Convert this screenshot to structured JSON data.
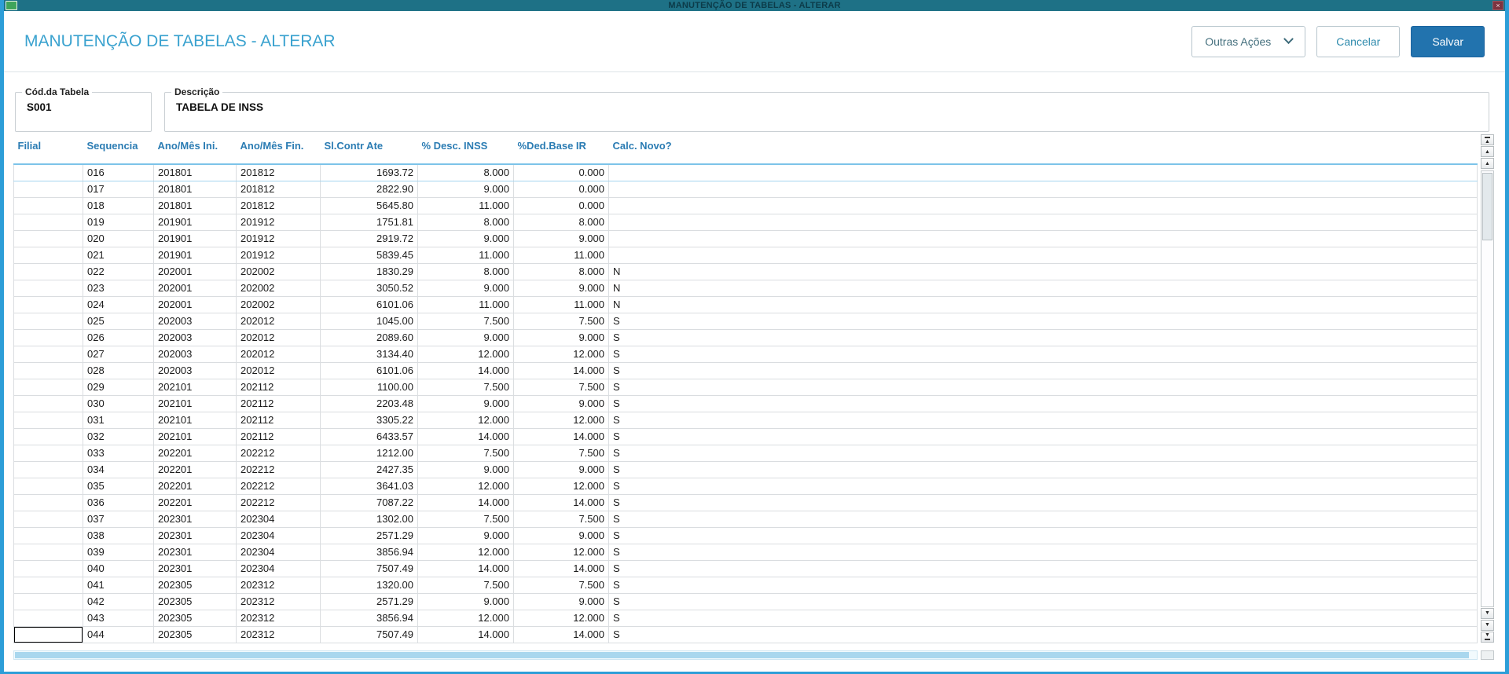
{
  "window": {
    "title": "MANUTENÇÃO DE TABELAS - ALTERAR",
    "close_glyph": "×"
  },
  "page": {
    "title": "MANUTENÇÃO DE TABELAS - ALTERAR",
    "actions": {
      "other_actions_label": "Outras Ações",
      "cancel_label": "Cancelar",
      "save_label": "Salvar"
    }
  },
  "form": {
    "table_code_label": "Cód.da Tabela",
    "table_code_value": "S001",
    "description_label": "Descrição",
    "description_value": "TABELA DE INSS"
  },
  "grid": {
    "columns": [
      "Filial",
      "Sequencia",
      "Ano/Mês Ini.",
      "Ano/Mês Fin.",
      "Sl.Contr Ate",
      "% Desc. INSS",
      "%Ded.Base IR",
      "Calc. Novo?"
    ],
    "column_align": [
      "left",
      "left",
      "left",
      "left",
      "right",
      "right",
      "right",
      "left"
    ],
    "selected_row_index": 0,
    "cursor_row_index": 28,
    "rows": [
      [
        "",
        "016",
        "201801",
        "201812",
        "1693.72",
        "8.000",
        "0.000",
        ""
      ],
      [
        "",
        "017",
        "201801",
        "201812",
        "2822.90",
        "9.000",
        "0.000",
        ""
      ],
      [
        "",
        "018",
        "201801",
        "201812",
        "5645.80",
        "11.000",
        "0.000",
        ""
      ],
      [
        "",
        "019",
        "201901",
        "201912",
        "1751.81",
        "8.000",
        "8.000",
        ""
      ],
      [
        "",
        "020",
        "201901",
        "201912",
        "2919.72",
        "9.000",
        "9.000",
        ""
      ],
      [
        "",
        "021",
        "201901",
        "201912",
        "5839.45",
        "11.000",
        "11.000",
        ""
      ],
      [
        "",
        "022",
        "202001",
        "202002",
        "1830.29",
        "8.000",
        "8.000",
        "N"
      ],
      [
        "",
        "023",
        "202001",
        "202002",
        "3050.52",
        "9.000",
        "9.000",
        "N"
      ],
      [
        "",
        "024",
        "202001",
        "202002",
        "6101.06",
        "11.000",
        "11.000",
        "N"
      ],
      [
        "",
        "025",
        "202003",
        "202012",
        "1045.00",
        "7.500",
        "7.500",
        "S"
      ],
      [
        "",
        "026",
        "202003",
        "202012",
        "2089.60",
        "9.000",
        "9.000",
        "S"
      ],
      [
        "",
        "027",
        "202003",
        "202012",
        "3134.40",
        "12.000",
        "12.000",
        "S"
      ],
      [
        "",
        "028",
        "202003",
        "202012",
        "6101.06",
        "14.000",
        "14.000",
        "S"
      ],
      [
        "",
        "029",
        "202101",
        "202112",
        "1100.00",
        "7.500",
        "7.500",
        "S"
      ],
      [
        "",
        "030",
        "202101",
        "202112",
        "2203.48",
        "9.000",
        "9.000",
        "S"
      ],
      [
        "",
        "031",
        "202101",
        "202112",
        "3305.22",
        "12.000",
        "12.000",
        "S"
      ],
      [
        "",
        "032",
        "202101",
        "202112",
        "6433.57",
        "14.000",
        "14.000",
        "S"
      ],
      [
        "",
        "033",
        "202201",
        "202212",
        "1212.00",
        "7.500",
        "7.500",
        "S"
      ],
      [
        "",
        "034",
        "202201",
        "202212",
        "2427.35",
        "9.000",
        "9.000",
        "S"
      ],
      [
        "",
        "035",
        "202201",
        "202212",
        "3641.03",
        "12.000",
        "12.000",
        "S"
      ],
      [
        "",
        "036",
        "202201",
        "202212",
        "7087.22",
        "14.000",
        "14.000",
        "S"
      ],
      [
        "",
        "037",
        "202301",
        "202304",
        "1302.00",
        "7.500",
        "7.500",
        "S"
      ],
      [
        "",
        "038",
        "202301",
        "202304",
        "2571.29",
        "9.000",
        "9.000",
        "S"
      ],
      [
        "",
        "039",
        "202301",
        "202304",
        "3856.94",
        "12.000",
        "12.000",
        "S"
      ],
      [
        "",
        "040",
        "202301",
        "202304",
        "7507.49",
        "14.000",
        "14.000",
        "S"
      ],
      [
        "",
        "041",
        "202305",
        "202312",
        "1320.00",
        "7.500",
        "7.500",
        "S"
      ],
      [
        "",
        "042",
        "202305",
        "202312",
        "2571.29",
        "9.000",
        "9.000",
        "S"
      ],
      [
        "",
        "043",
        "202305",
        "202312",
        "3856.94",
        "12.000",
        "12.000",
        "S"
      ],
      [
        "",
        "044",
        "202305",
        "202312",
        "7507.49",
        "14.000",
        "14.000",
        "S"
      ]
    ]
  },
  "scrollbar": {
    "up_glyph": "▲",
    "down_glyph": "▼"
  },
  "colors": {
    "accent": "#3aa2cf",
    "grid_header": "#2b7cb3",
    "save_button": "#2273ae",
    "titlebar": "#1e7186",
    "frame": "#2d9ed8",
    "scroll_thumb": "#a9d7ee"
  }
}
